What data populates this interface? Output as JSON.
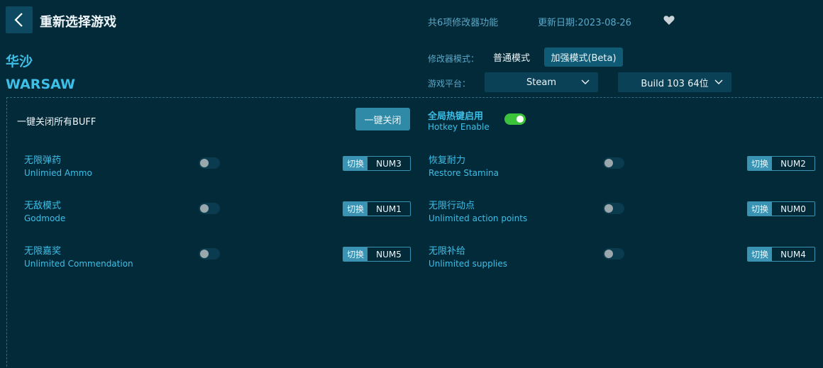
{
  "header": {
    "title": "重新选择游戏",
    "feature_count": "共6项修改器功能",
    "update_date": "更新日期:2023-08-26"
  },
  "game": {
    "name_cn": "华沙",
    "name_en": "WARSAW"
  },
  "mode": {
    "label": "修改器模式：",
    "normal": "普通模式",
    "beta": "加强模式(Beta)",
    "selected": "加强模式(Beta)"
  },
  "platform": {
    "label": "游戏平台：",
    "selected": "Steam",
    "build": "Build 103 64位"
  },
  "buff": {
    "label": "一键关闭所有BUFF",
    "button": "一键关闭"
  },
  "hotkey": {
    "label_cn": "全局热键启用",
    "label_en": "Hotkey Enable",
    "enabled": true
  },
  "switch_label": "切换",
  "features": [
    {
      "cn": "无限弹药",
      "en": "Unlimied Ammo",
      "key": "NUM3",
      "enabled": false
    },
    {
      "cn": "恢复耐力",
      "en": "Restore Stamina",
      "key": "NUM2",
      "enabled": false
    },
    {
      "cn": "无敌模式",
      "en": "Godmode",
      "key": "NUM1",
      "enabled": false
    },
    {
      "cn": "无限行动点",
      "en": "Unlimited action points",
      "key": "NUM0",
      "enabled": false
    },
    {
      "cn": "无限嘉奖",
      "en": "Unlimited Commendation",
      "key": "NUM5",
      "enabled": false
    },
    {
      "cn": "无限补给",
      "en": "Unlimited supplies",
      "key": "NUM4",
      "enabled": false
    }
  ],
  "colors": {
    "background": "#032a39",
    "accent": "#3dbfe8",
    "toggle_on": "#3cc33c",
    "button": "#2e8aa6"
  }
}
